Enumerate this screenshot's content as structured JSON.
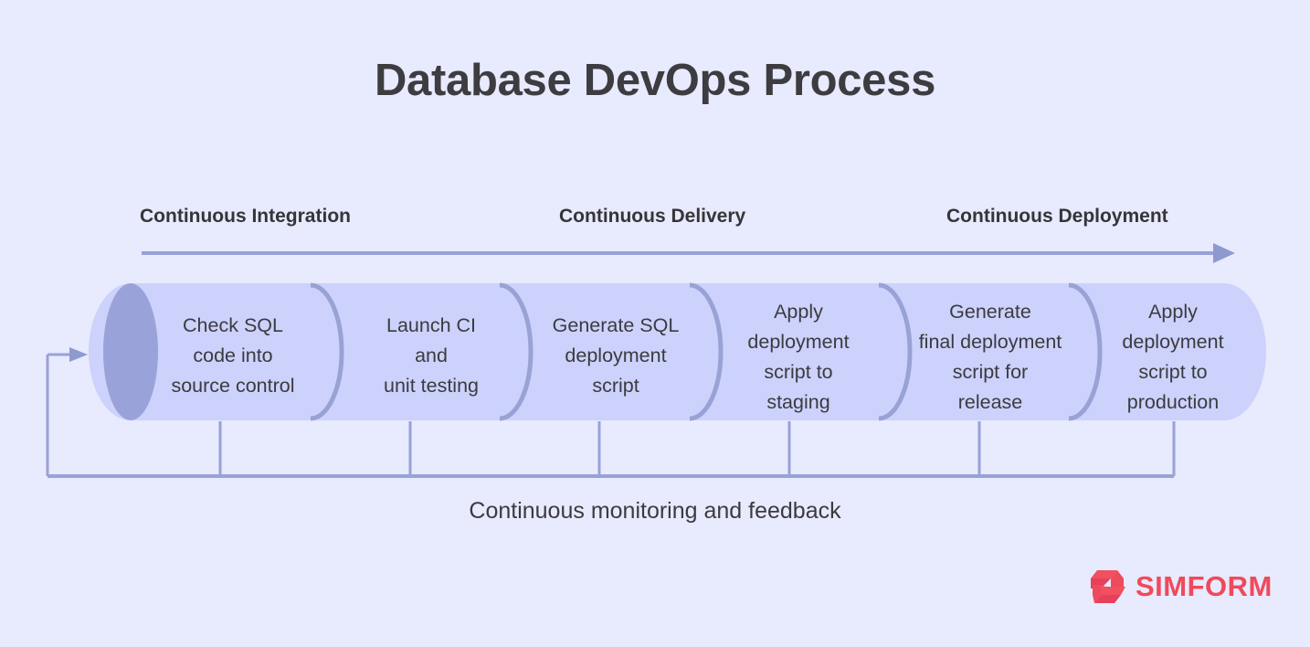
{
  "title": "Database DevOps Process",
  "colors": {
    "background": "#e8eafd",
    "cylinder_body": "#ccd2fb",
    "cylinder_cap": "#9aa3d9",
    "separator": "#98a2d5",
    "line": "#97a2d8",
    "title_text": "#3c3c41",
    "label_text": "#3b3b40",
    "brand": "#ef4a5c"
  },
  "timeline": {
    "phases": [
      {
        "label": "Continuous Integration"
      },
      {
        "label": "Continuous Delivery"
      },
      {
        "label": "Continuous Deployment"
      }
    ],
    "arrow_icon": "right-arrow-icon"
  },
  "pipeline": {
    "stages": [
      {
        "label": "Check SQL\ncode into\nsource control"
      },
      {
        "label": "Launch CI\nand\nunit testing"
      },
      {
        "label": "Generate SQL\ndeployment\nscript"
      },
      {
        "label": "Apply\ndeployment\nscript to\nstaging"
      },
      {
        "label": "Generate\nfinal deployment\nscript for\nrelease"
      },
      {
        "label": "Apply\ndeployment\nscript to\nproduction"
      }
    ]
  },
  "feedback": {
    "caption": "Continuous monitoring and feedback",
    "arrow_icon": "feedback-loop-arrow-icon"
  },
  "brand": {
    "name": "SIMFORM",
    "logo_icon": "simform-logo-icon"
  }
}
